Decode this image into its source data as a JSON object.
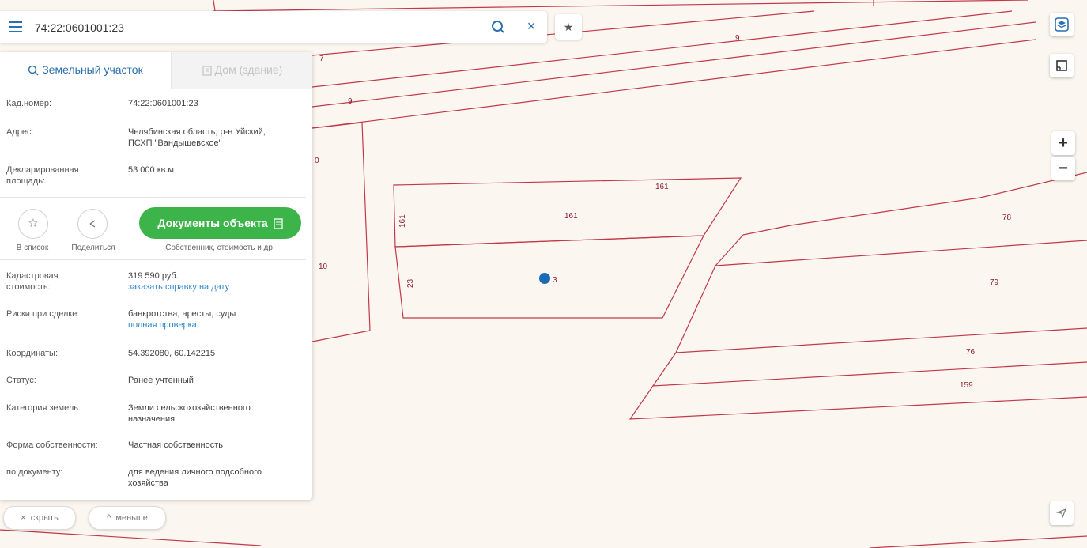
{
  "search": {
    "value": "74:22:0601001:23"
  },
  "tabs": {
    "land": "Земельный участок",
    "house": "Дом (здание)"
  },
  "info": {
    "cad_number": {
      "label": "Кад.номер:",
      "value": "74:22:0601001:23"
    },
    "address": {
      "label": "Адрес:",
      "line1": "Челябинская область, р-н Уйский,",
      "line2": "ПСХП \"Вандышевское\""
    },
    "area": {
      "label1": "Декларированная",
      "label2": "площадь:",
      "value": "53 000 кв.м"
    }
  },
  "actions": {
    "add_to_list": "В список",
    "share": "Поделиться",
    "docs_button": "Документы объекта",
    "docs_caption": "Собственник, стоимость и др."
  },
  "details": {
    "cadastral_cost": {
      "label1": "Кадастровая",
      "label2": "стоимость:",
      "value": "319 590 руб.",
      "link": "заказать справку на дату"
    },
    "risks": {
      "label": "Риски при сделке:",
      "value": "банкротства, аресты, суды",
      "link": "полная проверка"
    },
    "coordinates": {
      "label": "Координаты:",
      "value": "54.392080, 60.142215"
    },
    "status": {
      "label": "Статус:",
      "value": "Ранее учтенный"
    },
    "category": {
      "label": "Категория земель:",
      "line1": "Земли сельскохозяйственного",
      "line2": "назначения"
    },
    "ownership": {
      "label": "Форма собственности:",
      "value": "Частная собственность"
    },
    "by_document": {
      "label": "по документу:",
      "line1": "для ведения личного подсобного",
      "line2": "хозяйства"
    }
  },
  "bottom": {
    "hide": "скрыть",
    "less": "меньше"
  },
  "map": {
    "labels": [
      "7",
      "9",
      "9",
      "0",
      "10",
      "161",
      "161",
      "161",
      "23",
      "3",
      "78",
      "79",
      "76",
      "159"
    ],
    "zoom_in": "+",
    "zoom_out": "−"
  },
  "colors": {
    "accent": "#2a6fb0",
    "green": "#3cb44a",
    "parcel_line": "#c0394a",
    "marker": "#1a6bb5"
  }
}
